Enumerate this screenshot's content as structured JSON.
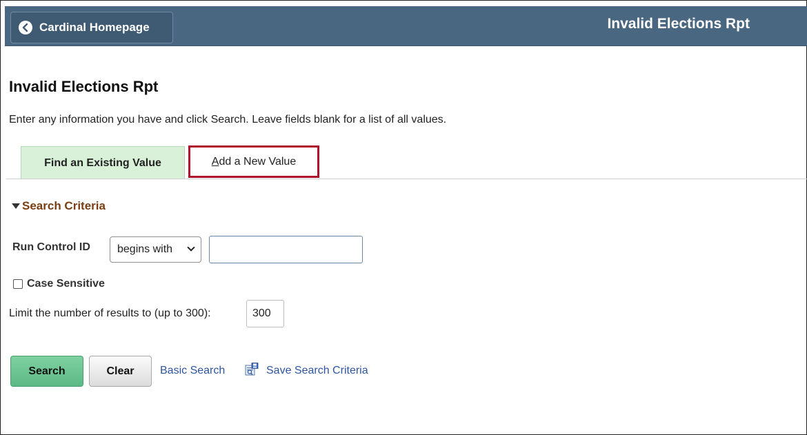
{
  "header": {
    "home_button_label": "Cardinal Homepage",
    "page_title": "Invalid Elections Rpt",
    "background_color": "#4a6781"
  },
  "main": {
    "title": "Invalid Elections Rpt",
    "instructions": "Enter any information you have and click Search. Leave fields blank for a list of all values.",
    "tabs": [
      {
        "label": "Find an Existing Value",
        "selected": true
      },
      {
        "label_prefix": "A",
        "label_rest": "dd a New Value",
        "selected": false,
        "highlighted": true
      }
    ],
    "search_criteria": {
      "toggle_label": "Search Criteria",
      "run_control_label": "Run Control ID",
      "operator_selected": "begins with",
      "run_control_value": "",
      "case_sensitive_label": "Case Sensitive",
      "case_sensitive_checked": false,
      "limit_label": "Limit the number of results to (up to 300):",
      "limit_value": "300"
    },
    "actions": {
      "search_label": "Search",
      "clear_label": "Clear",
      "basic_search_label": "Basic Search",
      "save_search_label": "Save Search Criteria"
    }
  },
  "colors": {
    "highlight_border": "#b0122b",
    "link": "#2d55a0",
    "search_button": "#5bb985",
    "criteria_heading": "#7a3e12"
  }
}
